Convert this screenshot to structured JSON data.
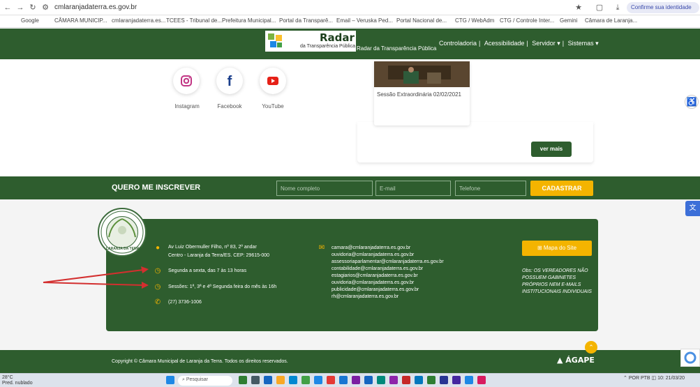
{
  "browser": {
    "url": "cmlaranjadaterra.es.gov.br",
    "identity_label": "Confirme sua identidade",
    "bookmarks": [
      "Google",
      "CÂMARA MUNICIP...",
      "cmlaranjadaterra.es...",
      "TCEES - Tribunal de...",
      "Prefeitura Municipal...",
      "Portal da Transparê...",
      "Email – Veruska Ped...",
      "Portal Nacional de...",
      "CTG / WebAdm",
      "CTG / Controle Inter...",
      "Gemini",
      "Câmara de Laranja..."
    ]
  },
  "site_nav": {
    "logo_title": "Radar",
    "logo_subtitle": "da Transparência Pública",
    "radar_text": "Radar da Transparência Pública",
    "menu": [
      "Controladoria",
      "Acessibilidade",
      "Servidor ▾",
      "Sistemas ▾"
    ]
  },
  "social": [
    {
      "label": "Instagram",
      "icon": "instagram-icon",
      "color": "#c13584"
    },
    {
      "label": "Facebook",
      "icon": "facebook-icon",
      "color": "#1b3f8c"
    },
    {
      "label": "YouTube",
      "icon": "youtube-icon",
      "color": "#e62117"
    }
  ],
  "session_card": {
    "caption": "Sessão Extraordinária 02/02/2021"
  },
  "ver_mais_label": "ver mais",
  "subscribe": {
    "title": "QUERO ME INSCREVER",
    "name_placeholder": "Nome completo",
    "email_placeholder": "E-mail",
    "phone_placeholder": "Telefone",
    "button_label": "CADASTRAR"
  },
  "footer": {
    "seal_text": "LARANJA DA TERRA",
    "address_line1": "Av Luiz Obermuller Filho, nº 83, 2º andar",
    "address_line2": "Centro - Laranja da Terra/ES. CEP: 29615-000",
    "hours": "Segunda a sexta, das 7 às 13 horas",
    "sessions": "Sessões: 1ª, 3ª e 4ª Segunda feira do mês às 16h",
    "phone": "(27) 3736-1006",
    "emails": [
      "camara@cmlaranjadaterra.es.gov.br",
      "ouvidoria@cmlaranjadaterra.es.gov.br",
      "assessoriaparlamentar@cmlaranjadaterra.es.gov.br",
      "contabilidade@cmlaranjadaterra.es.gov.br",
      "estagiarios@cmlaranjadaterra.es.gov.br",
      "ouvidoria@cmlaranjadaterra.es.gov.br",
      "publicidade@cmlaranjadaterra.es.gov.br",
      "rh@cmlaranjadaterra.es.gov.br"
    ],
    "sitemap_label": "Mapa do Site",
    "obs": "Obs: OS VEREADORES NÃO POSSUEM GABINETES PRÓPRIOS NEM E-MAILS INSTITUCIONAIS INDIVIDUAIS"
  },
  "copyright": {
    "text": "Copyright © Câmara Municipal de Laranja da Terra. Todos os direitos reservados.",
    "brand": "ÁGAPE"
  },
  "taskbar": {
    "weather_temp": "28°C",
    "weather_desc": "Pred. nublado",
    "search_placeholder": "Pesquisar",
    "lang": "POR PTB",
    "time": "10:",
    "date": "21/03/20"
  },
  "colors": {
    "brand_green": "#2e5d2e",
    "accent_yellow": "#f4b400",
    "annotation_red": "#d32f2f"
  }
}
